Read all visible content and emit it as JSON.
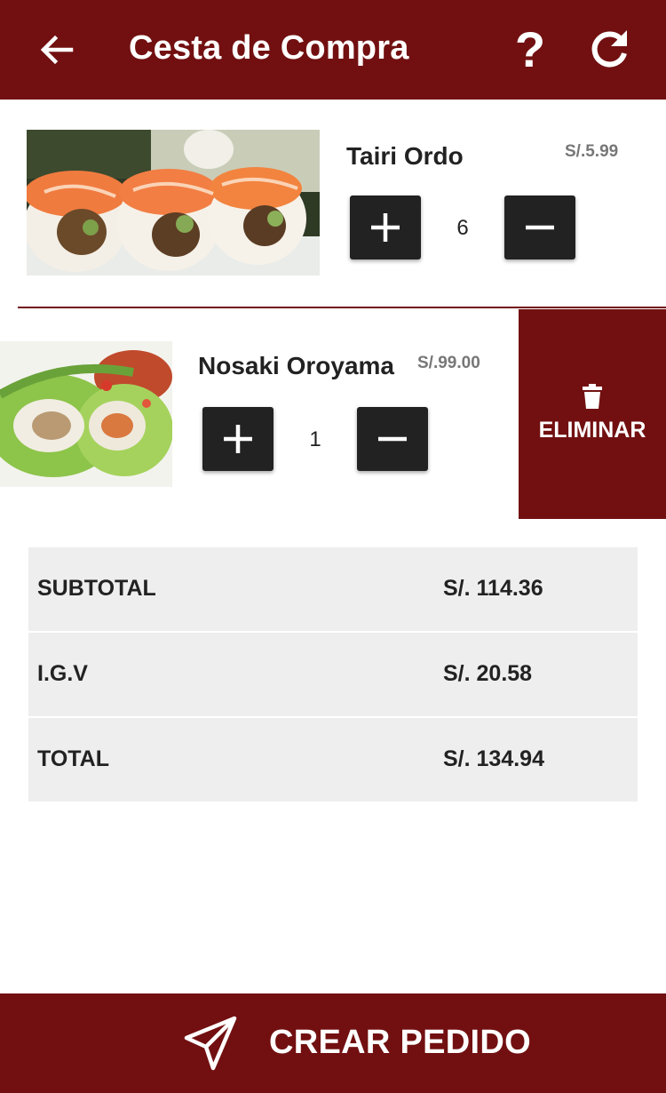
{
  "header": {
    "title": "Cesta de Compra",
    "back_icon": "arrow-left-icon",
    "help_icon": "question-mark-icon",
    "help_glyph": "?",
    "refresh_icon": "refresh-icon"
  },
  "cart": {
    "items": [
      {
        "name": "Tairi Ordo",
        "price": "S/.5.99",
        "quantity": "6",
        "image_icon": "sushi-roll-image"
      },
      {
        "name": "Nosaki Oroyama",
        "price": "S/.99.00",
        "quantity": "1",
        "image_icon": "sushi-wrap-image"
      }
    ],
    "delete_label": "ELIMINAR",
    "delete_icon": "trash-icon",
    "plus_icon": "plus-icon",
    "minus_icon": "minus-icon"
  },
  "totals": {
    "subtotal_label": "SUBTOTAL",
    "subtotal_value": "S/. 114.36",
    "igv_label": "I.G.V",
    "igv_value": "S/. 20.58",
    "total_label": "TOTAL",
    "total_value": "S/. 134.94"
  },
  "footer": {
    "cta_label": "CREAR PEDIDO",
    "cta_icon": "paper-plane-icon"
  },
  "colors": {
    "brand": "#721011",
    "button_dark": "#222222",
    "totals_bg": "#eeeeee",
    "price_gray": "#777777"
  }
}
